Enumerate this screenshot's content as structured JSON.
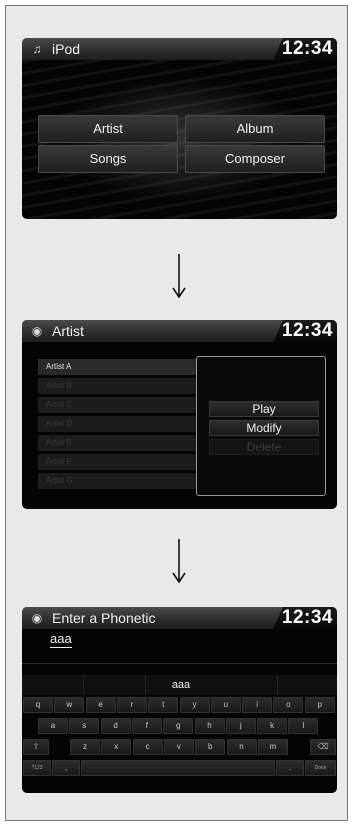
{
  "clock": "12:34",
  "screen1": {
    "title": "iPod",
    "title_icon": "music-note-icon",
    "buttons": [
      "Artist",
      "Album",
      "Songs",
      "Composer"
    ]
  },
  "screen2": {
    "title": "Artist",
    "title_icon": "disc-icon",
    "list": [
      "Artist A",
      "Artist B",
      "Artist C",
      "Artist D",
      "Artist E",
      "Artist F",
      "Artist G"
    ],
    "popup": {
      "play": "Play",
      "modify": "Modify",
      "delete": "Delete"
    }
  },
  "screen3": {
    "title": "Enter a Phonetic",
    "title_icon": "disc-icon",
    "input_value": "aaa",
    "suggestion": "aaa",
    "row1": [
      "q",
      "w",
      "e",
      "r",
      "t",
      "y",
      "u",
      "i",
      "o",
      "p"
    ],
    "row2": [
      "a",
      "s",
      "d",
      "f",
      "g",
      "h",
      "j",
      "k",
      "l"
    ],
    "row3": [
      "z",
      "x",
      "c",
      "v",
      "b",
      "n",
      "m"
    ],
    "shift": "⇧",
    "backspace": "⌫",
    "mode_key": "?123",
    "comma": ",",
    "period": ".",
    "done": "Done"
  }
}
